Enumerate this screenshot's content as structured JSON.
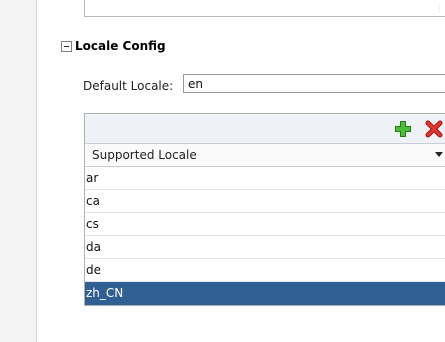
{
  "section": {
    "title": "Locale Config"
  },
  "default_locale": {
    "label": "Default Locale:",
    "value": "en"
  },
  "supported_locales": {
    "column_header": "Supported Locale",
    "rows": [
      {
        "value": "ar"
      },
      {
        "value": "ca"
      },
      {
        "value": "cs"
      },
      {
        "value": "da"
      },
      {
        "value": "de"
      },
      {
        "value": "zh_CN"
      }
    ],
    "selected_index": 5
  },
  "icons": {
    "add": "add-icon",
    "delete": "delete-icon",
    "collapse": "collapse-icon",
    "sort": "sort-arrow-icon"
  },
  "colors": {
    "add": "#3aa22a",
    "delete": "#d4231c",
    "selected_row": "#2f5f93"
  }
}
